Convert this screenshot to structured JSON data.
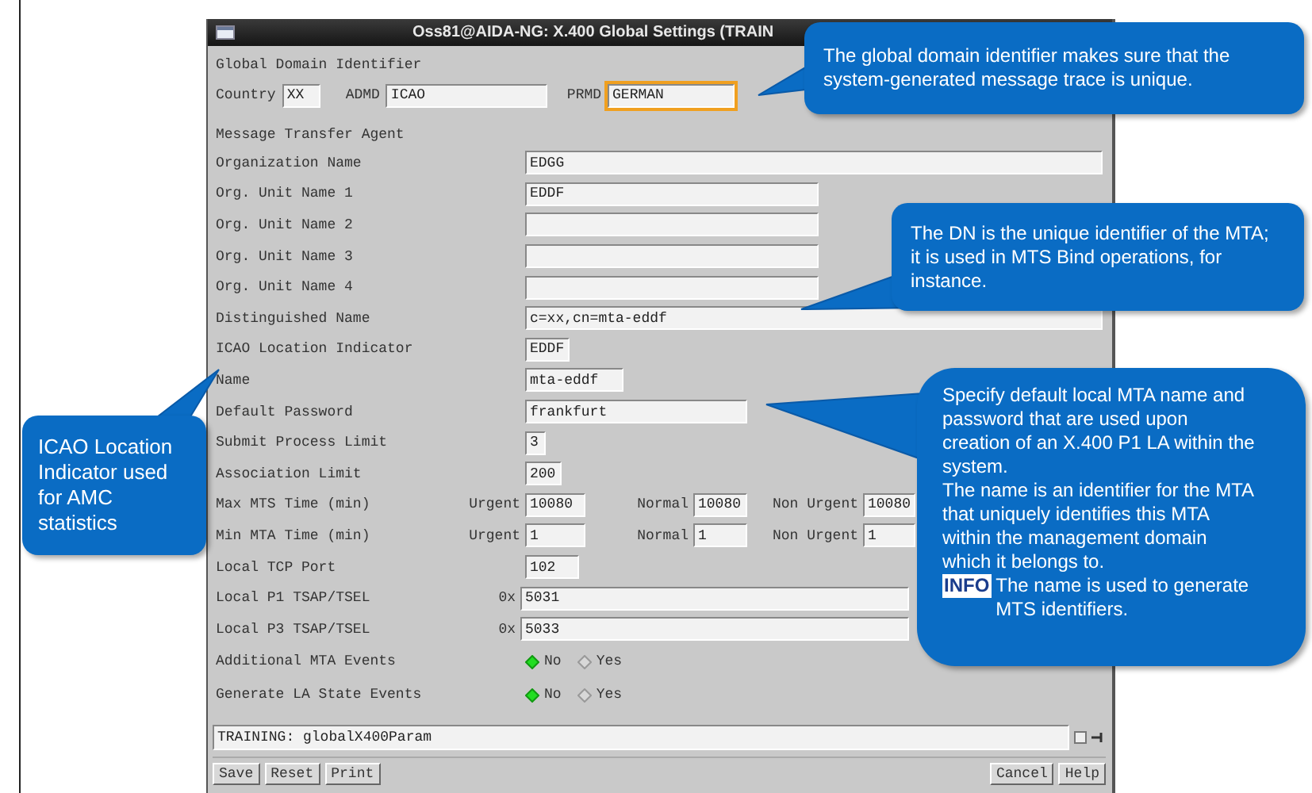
{
  "window": {
    "title": "Oss81@AIDA-NG: X.400 Global Settings (TRAIN"
  },
  "global_domain": {
    "heading": "Global Domain Identifier",
    "fields": [
      {
        "label": "Country",
        "value": "XX",
        "focused": false
      },
      {
        "label": "ADMD",
        "value": "ICAO",
        "focused": false
      },
      {
        "label": "PRMD",
        "value": "GERMAN",
        "focused": true
      }
    ]
  },
  "mta": {
    "heading": "Message Transfer Agent",
    "rows": [
      {
        "kind": "text",
        "label": "Organization Name",
        "value": "EDGG"
      },
      {
        "kind": "text",
        "label": "Org. Unit Name 1",
        "value": "EDDF"
      },
      {
        "kind": "text",
        "label": "Org. Unit Name 2"
      },
      {
        "kind": "text",
        "label": "Org. Unit Name 3"
      },
      {
        "kind": "text",
        "label": "Org. Unit Name 4"
      },
      {
        "kind": "text",
        "label": "Distinguished Name",
        "value": "c=xx,cn=mta-eddf"
      },
      {
        "kind": "text",
        "label": "ICAO Location Indicator",
        "value": "EDDF"
      },
      {
        "kind": "text",
        "label": "Name",
        "value": "mta-eddf"
      },
      {
        "kind": "text",
        "label": "Default Password",
        "value": "frankfurt"
      },
      {
        "kind": "text",
        "label": "Submit Process Limit",
        "value": "3"
      },
      {
        "kind": "text",
        "label": "Association Limit",
        "value": "200"
      },
      {
        "kind": "triple",
        "label": "Max MTS Time (min)",
        "parts": [
          {
            "label": "Urgent",
            "value": "10080"
          },
          {
            "label": "Normal",
            "value": "10080"
          },
          {
            "label": "Non Urgent",
            "value": "10080"
          }
        ]
      },
      {
        "kind": "triple",
        "label": "Min MTA Time (min)",
        "parts": [
          {
            "label": "Urgent",
            "value": "1"
          },
          {
            "label": "Normal",
            "value": "1"
          },
          {
            "label": "Non Urgent",
            "value": "1"
          }
        ]
      },
      {
        "kind": "text",
        "label": "Local TCP Port",
        "value": "102"
      },
      {
        "kind": "hex",
        "label": "Local P1 TSAP/TSEL",
        "prefix": "0x",
        "value": "5031"
      },
      {
        "kind": "hex",
        "label": "Local P3 TSAP/TSEL",
        "prefix": "0x",
        "value": "5033"
      },
      {
        "kind": "radio",
        "label": "Additional MTA Events",
        "options": [
          {
            "label": "No",
            "selected": true
          },
          {
            "label": "Yes",
            "selected": false
          }
        ]
      },
      {
        "kind": "radio",
        "label": "Generate LA State Events",
        "options": [
          {
            "label": "No",
            "selected": true
          },
          {
            "label": "Yes",
            "selected": false
          }
        ]
      }
    ]
  },
  "status_field": {
    "value": "TRAINING: globalX400Param"
  },
  "buttons_left": [
    "Save",
    "Reset",
    "Print"
  ],
  "buttons_right": [
    "Cancel",
    "Help"
  ],
  "callouts": [
    {
      "kind": "gdi",
      "text": "The global domain identifier makes sure that the system-generated message trace is unique."
    },
    {
      "kind": "dn",
      "text": "The DN is the unique identifier of the MTA; it is used in MTS Bind operations, for instance."
    },
    {
      "kind": "icao",
      "text": "ICAO Location Indicator used for AMC statistics"
    },
    {
      "kind": "name",
      "text": "Specify default local MTA name and password that are used upon creation of an X.400 P1 LA within the system.\nThe name is an identifier for the MTA that uniquely identifies this MTA within the management domain which it belongs to.",
      "badge": "INFO",
      "note": "The name is used to generate MTS identifiers."
    }
  ]
}
